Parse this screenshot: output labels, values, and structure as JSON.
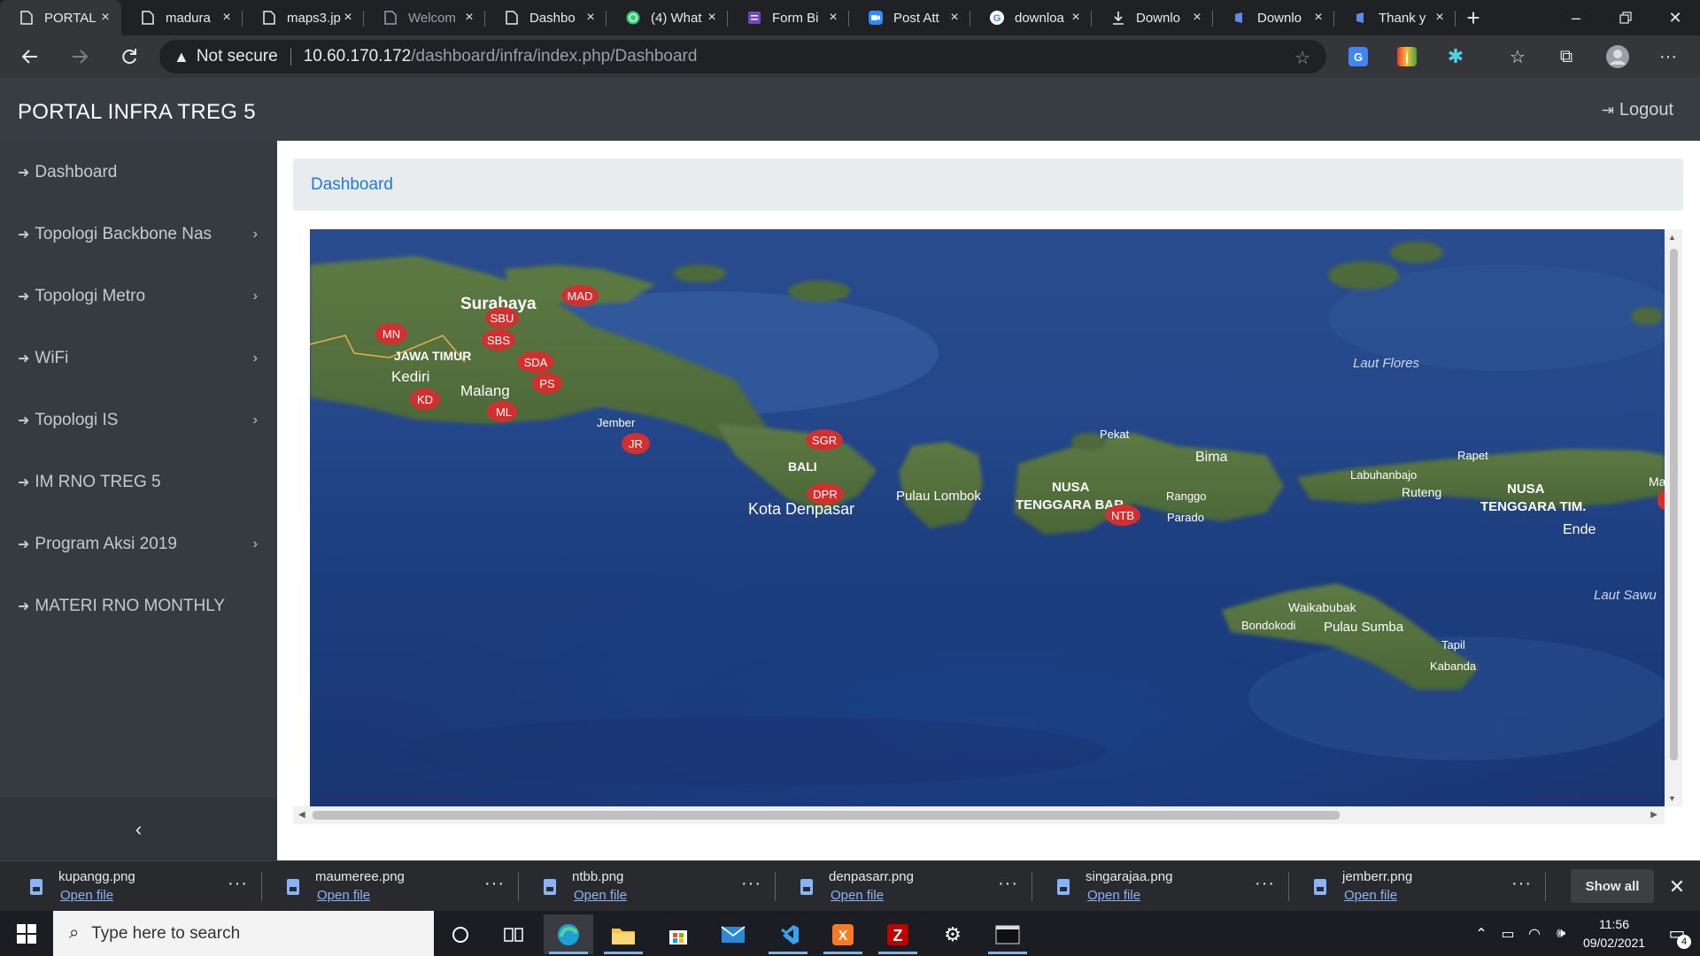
{
  "browser": {
    "tabs": [
      {
        "title": "PORTAL",
        "icon": "page-icon",
        "active": true
      },
      {
        "title": "madura",
        "icon": "page-icon"
      },
      {
        "title": "maps3.jp",
        "icon": "page-icon"
      },
      {
        "title": "Welcom",
        "icon": "page-icon"
      },
      {
        "title": "Dashbo",
        "icon": "page-icon"
      },
      {
        "title": "(4) What",
        "icon": "whatsapp-icon"
      },
      {
        "title": "Form Bi",
        "icon": "forms-icon"
      },
      {
        "title": "Post Att",
        "icon": "zoom-icon"
      },
      {
        "title": "downloa",
        "icon": "google-icon"
      },
      {
        "title": "Downlo",
        "icon": "download-icon"
      },
      {
        "title": "Downlo",
        "icon": "app-icon"
      },
      {
        "title": "Thank y",
        "icon": "app-icon"
      }
    ],
    "security_label": "Not secure",
    "url_host": "10.60.170.172",
    "url_path": "/dashboard/infra/index.php/Dashboard"
  },
  "header": {
    "brand": "PORTAL INFRA TREG 5",
    "logout_label": "Logout"
  },
  "sidebar": {
    "items": [
      {
        "label": "Dashboard",
        "has_submenu": false
      },
      {
        "label": "Topologi Backbone Nas",
        "has_submenu": true
      },
      {
        "label": "Topologi Metro",
        "has_submenu": true
      },
      {
        "label": "WiFi",
        "has_submenu": true
      },
      {
        "label": "Topologi IS",
        "has_submenu": true
      },
      {
        "label": "IM RNO TREG 5",
        "has_submenu": false
      },
      {
        "label": "Program Aksi 2019",
        "has_submenu": true
      },
      {
        "label": "MATERI RNO MONTHLY",
        "has_submenu": false
      }
    ],
    "collapse_glyph": "‹"
  },
  "main": {
    "breadcrumb": "Dashboard",
    "map": {
      "place_labels": [
        "Surabaya",
        "JAWA TIMUR",
        "Kediri",
        "Malang",
        "Jember",
        "BALI",
        "Kota Denpasar",
        "Pulau Lombok",
        "NUSA",
        "TENGGARA BAR",
        "Pekat",
        "Bima",
        "Ranggo",
        "Parado",
        "Labuhanbajo",
        "Rapet",
        "Ruteng",
        "NUSA",
        "TENGGARA TIM.",
        "Ende",
        "Laut Flores",
        "Laut Sawu",
        "Waikabubak",
        "Bondokodi",
        "Pulau Sumba",
        "Tapil",
        "Kabanda",
        "Ma"
      ],
      "markers": [
        "MAD",
        "SBU",
        "SBS",
        "MN",
        "SDA",
        "PS",
        "KD",
        "ML",
        "JR",
        "SGR",
        "DPR",
        "NTB"
      ]
    }
  },
  "downloads": {
    "items": [
      {
        "filename": "kupangg.png",
        "action": "Open file"
      },
      {
        "filename": "maumeree.png",
        "action": "Open file"
      },
      {
        "filename": "ntbb.png",
        "action": "Open file"
      },
      {
        "filename": "denpasarr.png",
        "action": "Open file"
      },
      {
        "filename": "singarajaa.png",
        "action": "Open file"
      },
      {
        "filename": "jemberr.png",
        "action": "Open file"
      }
    ],
    "show_all_label": "Show all"
  },
  "taskbar": {
    "search_placeholder": "Type here to search",
    "time": "11:56",
    "date": "09/02/2021",
    "notification_count": "4"
  }
}
